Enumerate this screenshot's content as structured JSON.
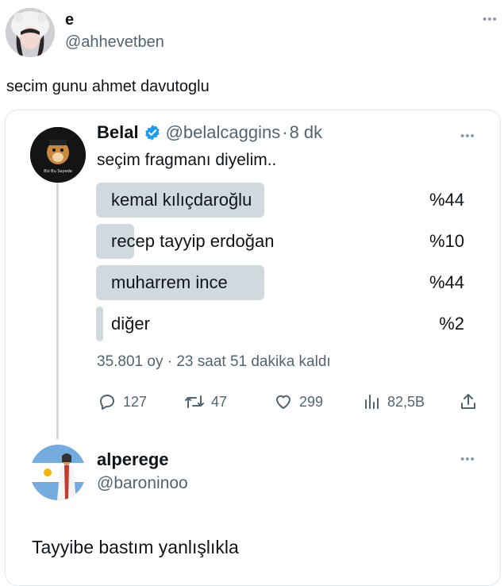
{
  "outer_tweet": {
    "display_name": "e",
    "handle": "@ahhevetben",
    "text": "secim gunu ahmet davutoglu",
    "more_icon": "more-dots-icon"
  },
  "quoted_tweet": {
    "display_name": "Belal",
    "verified_icon": "verified-badge-icon",
    "handle": "@belalcaggins",
    "separator": "·",
    "time": "8 dk",
    "text": "seçim fragmanı diyelim..",
    "avatar_caption": "Biz Bu Sayede",
    "poll": {
      "options": [
        {
          "label": "kemal kılıçdaroğlu",
          "percent_text": "%44",
          "fraction": 0.44
        },
        {
          "label": "recep tayyip erdoğan",
          "percent_text": "%10",
          "fraction": 0.1
        },
        {
          "label": "muharrem ince",
          "percent_text": "%44",
          "fraction": 0.44
        },
        {
          "label": "diğer",
          "percent_text": "%2",
          "fraction": 0.02
        }
      ],
      "summary": "35.801 oy · 23 saat 51 dakika kaldı"
    },
    "actions": {
      "replies": "127",
      "retweets": "47",
      "likes": "299",
      "views": "82,5B"
    }
  },
  "reply_tweet": {
    "display_name": "alperege",
    "handle": "@baroninoo",
    "text": "Tayyibe bastım yanlışlıkla"
  },
  "colors": {
    "poll_bar": "#cfd9de",
    "verified": "#1d9bf0",
    "muted_text": "#536471",
    "argentina_blue": "#74acdf"
  }
}
